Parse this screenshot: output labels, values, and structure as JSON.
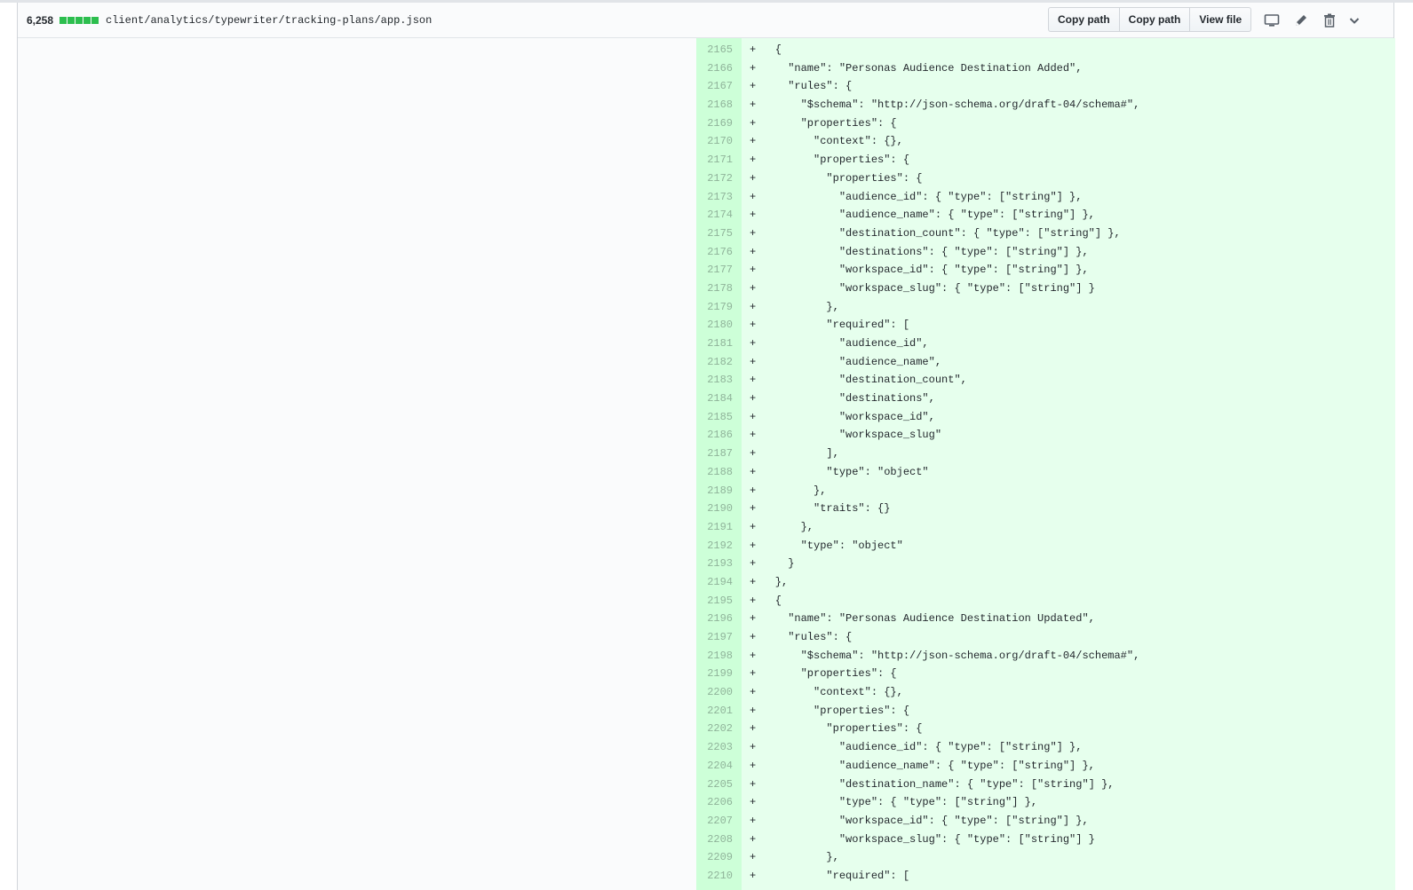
{
  "file": {
    "additions_count": "6,258",
    "path": "client/analytics/typewriter/tracking-plans/app.json",
    "stat_color": "#2cbe4e"
  },
  "toolbar": {
    "copy_path_1": "Copy path",
    "copy_path_2": "Copy path",
    "view_file": "View file",
    "icons": [
      "desktop-icon",
      "pencil-icon",
      "trash-icon",
      "chevron-down-icon"
    ]
  },
  "diff": {
    "added_bg": "#e6ffed",
    "added_num_bg": "#cdffd8",
    "lines": [
      {
        "num": "2165",
        "text": "+   {"
      },
      {
        "num": "2166",
        "text": "+     \"name\": \"Personas Audience Destination Added\","
      },
      {
        "num": "2167",
        "text": "+     \"rules\": {"
      },
      {
        "num": "2168",
        "text": "+       \"$schema\": \"http://json-schema.org/draft-04/schema#\","
      },
      {
        "num": "2169",
        "text": "+       \"properties\": {"
      },
      {
        "num": "2170",
        "text": "+         \"context\": {},"
      },
      {
        "num": "2171",
        "text": "+         \"properties\": {"
      },
      {
        "num": "2172",
        "text": "+           \"properties\": {"
      },
      {
        "num": "2173",
        "text": "+             \"audience_id\": { \"type\": [\"string\"] },"
      },
      {
        "num": "2174",
        "text": "+             \"audience_name\": { \"type\": [\"string\"] },"
      },
      {
        "num": "2175",
        "text": "+             \"destination_count\": { \"type\": [\"string\"] },"
      },
      {
        "num": "2176",
        "text": "+             \"destinations\": { \"type\": [\"string\"] },"
      },
      {
        "num": "2177",
        "text": "+             \"workspace_id\": { \"type\": [\"string\"] },"
      },
      {
        "num": "2178",
        "text": "+             \"workspace_slug\": { \"type\": [\"string\"] }"
      },
      {
        "num": "2179",
        "text": "+           },"
      },
      {
        "num": "2180",
        "text": "+           \"required\": ["
      },
      {
        "num": "2181",
        "text": "+             \"audience_id\","
      },
      {
        "num": "2182",
        "text": "+             \"audience_name\","
      },
      {
        "num": "2183",
        "text": "+             \"destination_count\","
      },
      {
        "num": "2184",
        "text": "+             \"destinations\","
      },
      {
        "num": "2185",
        "text": "+             \"workspace_id\","
      },
      {
        "num": "2186",
        "text": "+             \"workspace_slug\""
      },
      {
        "num": "2187",
        "text": "+           ],"
      },
      {
        "num": "2188",
        "text": "+           \"type\": \"object\""
      },
      {
        "num": "2189",
        "text": "+         },"
      },
      {
        "num": "2190",
        "text": "+         \"traits\": {}"
      },
      {
        "num": "2191",
        "text": "+       },"
      },
      {
        "num": "2192",
        "text": "+       \"type\": \"object\""
      },
      {
        "num": "2193",
        "text": "+     }"
      },
      {
        "num": "2194",
        "text": "+   },"
      },
      {
        "num": "2195",
        "text": "+   {"
      },
      {
        "num": "2196",
        "text": "+     \"name\": \"Personas Audience Destination Updated\","
      },
      {
        "num": "2197",
        "text": "+     \"rules\": {"
      },
      {
        "num": "2198",
        "text": "+       \"$schema\": \"http://json-schema.org/draft-04/schema#\","
      },
      {
        "num": "2199",
        "text": "+       \"properties\": {"
      },
      {
        "num": "2200",
        "text": "+         \"context\": {},"
      },
      {
        "num": "2201",
        "text": "+         \"properties\": {"
      },
      {
        "num": "2202",
        "text": "+           \"properties\": {"
      },
      {
        "num": "2203",
        "text": "+             \"audience_id\": { \"type\": [\"string\"] },"
      },
      {
        "num": "2204",
        "text": "+             \"audience_name\": { \"type\": [\"string\"] },"
      },
      {
        "num": "2205",
        "text": "+             \"destination_name\": { \"type\": [\"string\"] },"
      },
      {
        "num": "2206",
        "text": "+             \"type\": { \"type\": [\"string\"] },"
      },
      {
        "num": "2207",
        "text": "+             \"workspace_id\": { \"type\": [\"string\"] },"
      },
      {
        "num": "2208",
        "text": "+             \"workspace_slug\": { \"type\": [\"string\"] }"
      },
      {
        "num": "2209",
        "text": "+           },"
      },
      {
        "num": "2210",
        "text": "+           \"required\": ["
      }
    ]
  }
}
